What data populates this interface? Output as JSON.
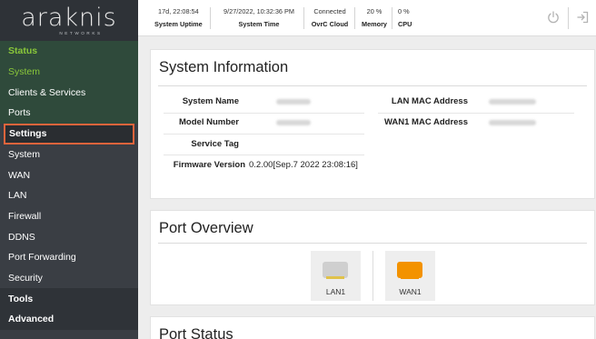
{
  "app": {
    "brand": "araknis",
    "brand_sub": "NETWORKS"
  },
  "sidebar": {
    "items": [
      {
        "label": "Status",
        "kind": "section"
      },
      {
        "label": "System",
        "kind": "sub-active"
      },
      {
        "label": "Clients & Services",
        "kind": "sub"
      },
      {
        "label": "Ports",
        "kind": "sub"
      },
      {
        "label": "Settings",
        "kind": "section-highlighted"
      },
      {
        "label": "System",
        "kind": "sub"
      },
      {
        "label": "WAN",
        "kind": "sub"
      },
      {
        "label": "LAN",
        "kind": "sub"
      },
      {
        "label": "Firewall",
        "kind": "sub"
      },
      {
        "label": "DDNS",
        "kind": "sub"
      },
      {
        "label": "Port Forwarding",
        "kind": "sub"
      },
      {
        "label": "Security",
        "kind": "sub"
      },
      {
        "label": "Tools",
        "kind": "section"
      },
      {
        "label": "Advanced",
        "kind": "section"
      }
    ]
  },
  "topbar": {
    "uptime": {
      "value": "17d, 22:08:54",
      "label": "System Uptime"
    },
    "time": {
      "value": "9/27/2022, 10:32:36 PM",
      "label": "System Time"
    },
    "cloud": {
      "value": "Connected",
      "label": "OvrC Cloud"
    },
    "memory": {
      "value": "20 %",
      "label": "Memory"
    },
    "cpu": {
      "value": "0 %",
      "label": "CPU"
    },
    "icons": [
      "power-icon",
      "logout-icon"
    ]
  },
  "system_info": {
    "title": "System Information",
    "left": [
      {
        "label": "System Name",
        "value": ""
      },
      {
        "label": "Model Number",
        "value": ""
      },
      {
        "label": "Service Tag",
        "value": ""
      },
      {
        "label": "Firmware Version",
        "value": "0.2.00[Sep.7 2022 23:08:16]"
      }
    ],
    "right": [
      {
        "label": "LAN MAC Address",
        "value": ""
      },
      {
        "label": "WAN1 MAC Address",
        "value": ""
      }
    ]
  },
  "port_overview": {
    "title": "Port Overview",
    "ports": [
      {
        "label": "LAN1",
        "status_color": "#cfcfcf"
      },
      {
        "label": "WAN1",
        "status_color": "#f39200"
      }
    ]
  },
  "port_status": {
    "title": "Port Status"
  },
  "colors": {
    "accent_green": "#89c73a",
    "highlight_outline": "#e0643c",
    "sidebar_bg": "#3a3e44"
  }
}
